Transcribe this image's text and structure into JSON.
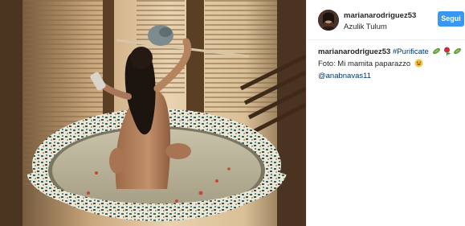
{
  "post": {
    "username": "marianarodriguez53",
    "location": "Azulik Tulum",
    "follow_label": "Segui",
    "caption": {
      "username": "marianarodriguez53",
      "hashtag": "#Purificate",
      "line2": "Foto: Mi mamita paparazzo",
      "mention": "@anabnavas11"
    },
    "caption_emojis": [
      "cucumber-emoji",
      "rose-emoji",
      "cucumber-emoji"
    ],
    "line2_emoji": "grinning-face-emoji"
  },
  "colors": {
    "follow_button": "#3897f0",
    "link": "#003569",
    "text": "#262626",
    "divider": "#efefef"
  },
  "icons": {
    "avatar": "profile-photo"
  }
}
